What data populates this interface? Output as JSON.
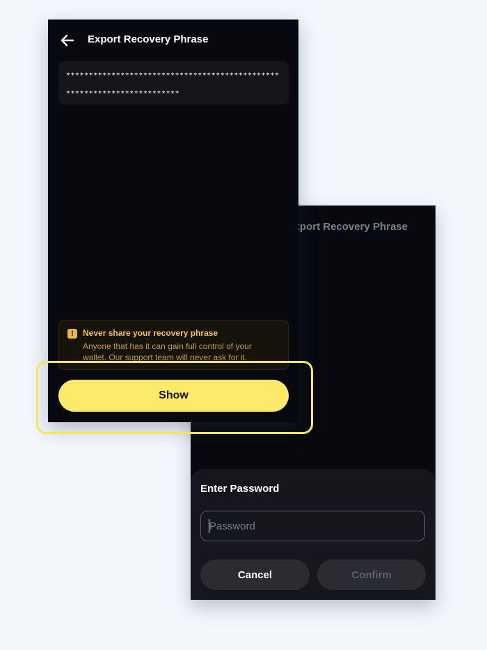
{
  "front_screen": {
    "title": "Export Recovery Phrase",
    "phrase_mask": "************************************************************************",
    "warning": {
      "title": "Never share your recovery phrase",
      "body": "Anyone that has it can gain full control of your wallet. Our support team will never ask for it."
    },
    "show_button": "Show"
  },
  "back_screen": {
    "title": "Export Recovery Phrase",
    "phrase_mask": "************************************************************************",
    "dialog": {
      "title": "Enter Password",
      "password_placeholder": "Password",
      "cancel_button": "Cancel",
      "confirm_button": "Confirm"
    }
  },
  "colors": {
    "background": "#f3f6fb",
    "panel": "#07090e",
    "accent_yellow": "#fdea68",
    "warning_text": "#f5c451",
    "highlight": "#f6e65f"
  },
  "icons": {
    "back": "arrow-left-icon",
    "warning": "exclamation-icon"
  }
}
